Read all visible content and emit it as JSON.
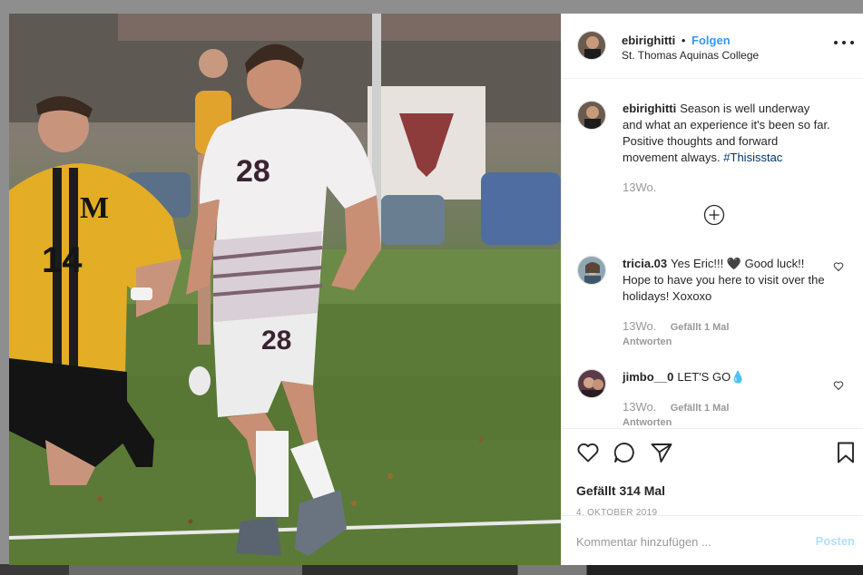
{
  "post": {
    "username": "ebirighitti",
    "follow_label": "Folgen",
    "separator": "•",
    "location": "St. Thomas Aquinas College",
    "likes": "Gefällt 314 Mal",
    "date": "4. OKTOBER 2019"
  },
  "photo": {
    "jersey_left": "28",
    "shorts_number": "28",
    "opponent_number": "14",
    "opponent_letter": "M"
  },
  "comments": [
    {
      "username": "ebirighitti",
      "text": "Season is well underway and what an experience it's been so far. Positive thoughts and forward movement always.",
      "hashtag": "#Thisisstac",
      "time": "13Wo."
    },
    {
      "username": "tricia.03",
      "text": "Yes Eric!!! 🖤 Good luck!! Hope to have you here to visit over the holidays! Xoxoxo",
      "time": "13Wo.",
      "likes": "Gefällt 1 Mal",
      "reply": "Antworten"
    },
    {
      "username": "jimbo__0",
      "text": "LET'S GO💧",
      "time": "13Wo.",
      "likes": "Gefällt 1 Mal",
      "reply": "Antworten"
    }
  ],
  "add_comment": {
    "placeholder": "Kommentar hinzufügen ...",
    "post_label": "Posten"
  },
  "icons": {
    "more": "more-horizontal-icon",
    "load_more": "plus-circle-icon",
    "like": "heart-icon",
    "comment": "comment-bubble-icon",
    "share": "paper-plane-icon",
    "save": "bookmark-icon"
  },
  "colors": {
    "link_blue": "#3897f0",
    "hashtag": "#003569",
    "muted": "#999999",
    "post_disabled": "#b2dffc"
  }
}
